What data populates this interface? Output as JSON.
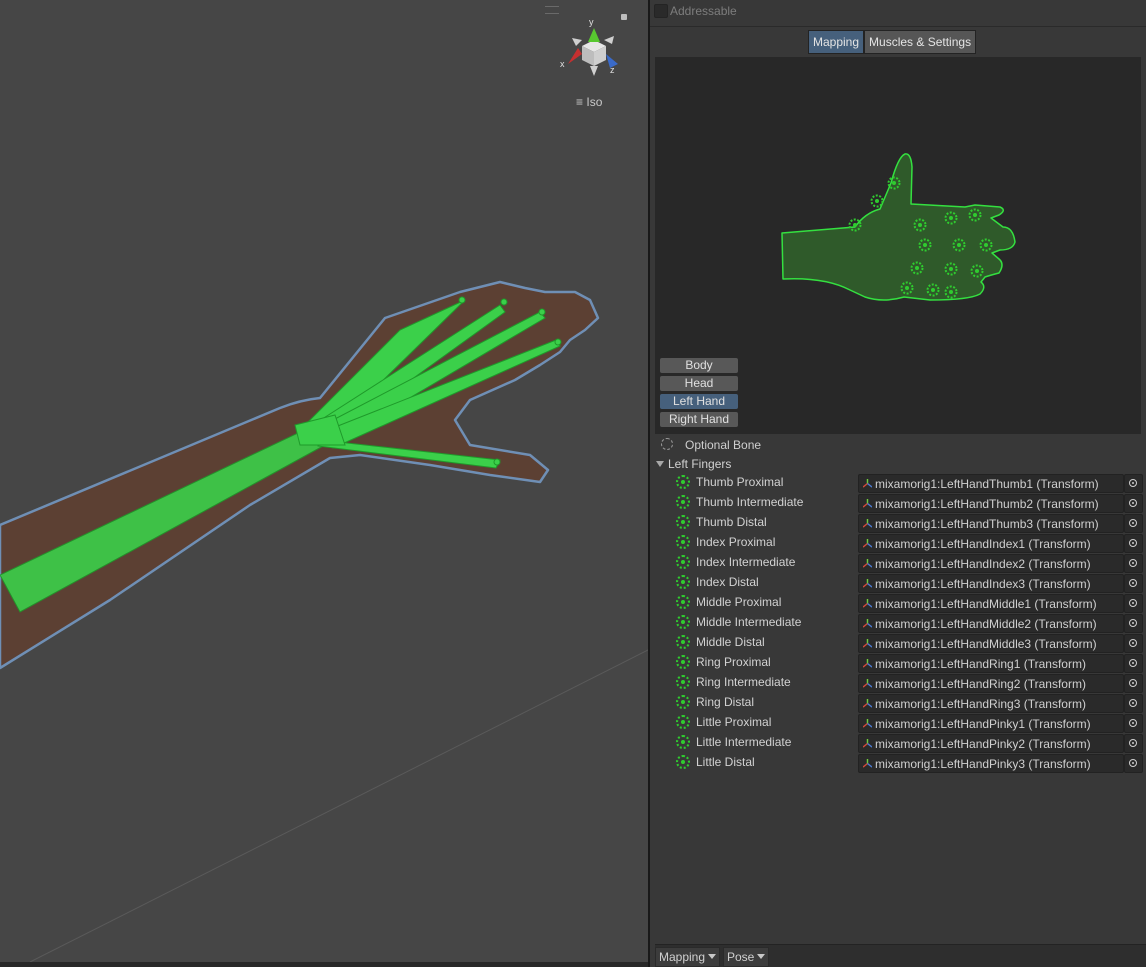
{
  "scene": {
    "projection_label": "Iso",
    "gizmo": {
      "axes": [
        "y",
        "x",
        "z"
      ]
    }
  },
  "inspector": {
    "addressable_label": "Addressable",
    "tabs": [
      {
        "label": "Mapping",
        "active": true
      },
      {
        "label": "Muscles & Settings",
        "active": false
      }
    ],
    "body_parts": [
      {
        "label": "Body",
        "active": false
      },
      {
        "label": "Head",
        "active": false
      },
      {
        "label": "Left Hand",
        "active": true
      },
      {
        "label": "Right Hand",
        "active": false
      }
    ],
    "optional_bone_label": "Optional Bone",
    "group_label": "Left Fingers",
    "bones": [
      {
        "name": "Thumb Proximal",
        "value": "mixamorig1:LeftHandThumb1 (Transform)"
      },
      {
        "name": "Thumb Intermediate",
        "value": "mixamorig1:LeftHandThumb2 (Transform)"
      },
      {
        "name": "Thumb Distal",
        "value": "mixamorig1:LeftHandThumb3 (Transform)"
      },
      {
        "name": "Index Proximal",
        "value": "mixamorig1:LeftHandIndex1 (Transform)"
      },
      {
        "name": "Index Intermediate",
        "value": "mixamorig1:LeftHandIndex2 (Transform)"
      },
      {
        "name": "Index Distal",
        "value": "mixamorig1:LeftHandIndex3 (Transform)"
      },
      {
        "name": "Middle Proximal",
        "value": "mixamorig1:LeftHandMiddle1 (Transform)"
      },
      {
        "name": "Middle Intermediate",
        "value": "mixamorig1:LeftHandMiddle2 (Transform)"
      },
      {
        "name": "Middle Distal",
        "value": "mixamorig1:LeftHandMiddle3 (Transform)"
      },
      {
        "name": "Ring Proximal",
        "value": "mixamorig1:LeftHandRing1 (Transform)"
      },
      {
        "name": "Ring Intermediate",
        "value": "mixamorig1:LeftHandRing2 (Transform)"
      },
      {
        "name": "Ring Distal",
        "value": "mixamorig1:LeftHandRing3 (Transform)"
      },
      {
        "name": "Little Proximal",
        "value": "mixamorig1:LeftHandPinky1 (Transform)"
      },
      {
        "name": "Little Intermediate",
        "value": "mixamorig1:LeftHandPinky2 (Transform)"
      },
      {
        "name": "Little Distal",
        "value": "mixamorig1:LeftHandPinky3 (Transform)"
      }
    ],
    "footer": {
      "mapping_label": "Mapping",
      "pose_label": "Pose"
    }
  },
  "colors": {
    "bone_green": "#2fcc2f",
    "active_blue": "#46607c",
    "skin": "#5c4033"
  }
}
